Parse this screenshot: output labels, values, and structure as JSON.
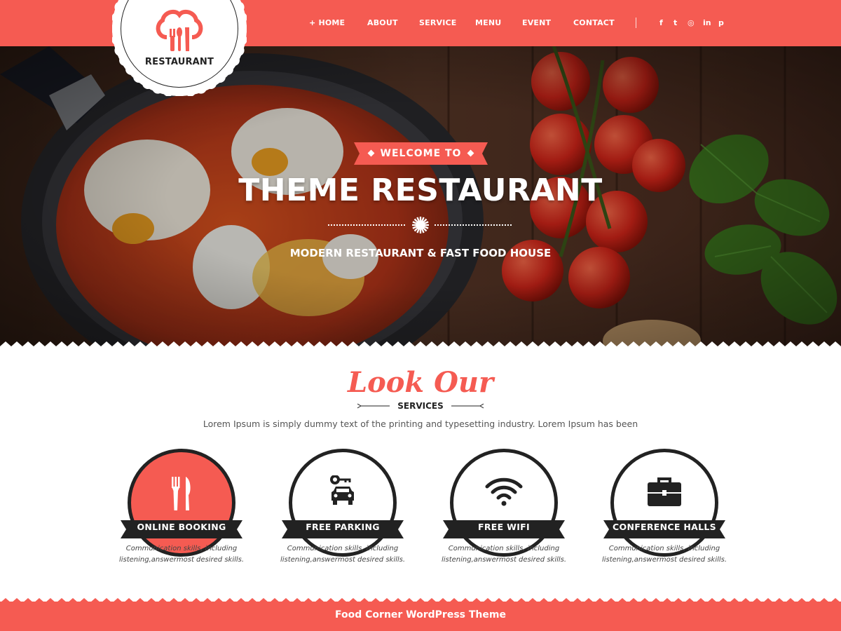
{
  "brand": {
    "logo_text": "RESTAURANT",
    "accent_color": "#f55b52",
    "dark_color": "#222222"
  },
  "nav": {
    "items": [
      "+ HOME",
      "ABOUT",
      "SERVICE",
      "MENU",
      "EVENT",
      "CONTACT"
    ]
  },
  "social": {
    "icons": [
      {
        "name": "facebook-icon",
        "glyph": "f"
      },
      {
        "name": "twitter-icon",
        "glyph": "t"
      },
      {
        "name": "instagram-icon",
        "glyph": "◎"
      },
      {
        "name": "linkedin-icon",
        "glyph": "in"
      },
      {
        "name": "pinterest-icon",
        "glyph": "p"
      }
    ]
  },
  "hero": {
    "tag": "WELCOME TO",
    "title": "THEME RESTAURANT",
    "subtitle": "MODERN RESTAURANT & FAST FOOD HOUSE"
  },
  "services": {
    "title": "Look Our",
    "subtitle": "SERVICES",
    "description": "Lorem Ipsum is simply dummy text of the printing and typesetting industry. Lorem Ipsum has been",
    "cards": [
      {
        "label": "ONLINE BOOKING",
        "icon": "cutlery-icon",
        "active": true,
        "desc_line1": "Communication skills, including",
        "desc_line2": "listening,answermost desired skills."
      },
      {
        "label": "FREE PARKING",
        "icon": "car-key-icon",
        "active": false,
        "desc_line1": "Communication skills, including",
        "desc_line2": "listening,answermost desired skills."
      },
      {
        "label": "FREE WIFI",
        "icon": "wifi-icon",
        "active": false,
        "desc_line1": "Communication skills, including",
        "desc_line2": "listening,answermost desired skills."
      },
      {
        "label": "CONFERENCE HALLS",
        "icon": "briefcase-icon",
        "active": false,
        "desc_line1": "Communication skills, including",
        "desc_line2": "listening,answermost desired skills."
      }
    ]
  },
  "footer": {
    "text": "Food Corner WordPress Theme"
  }
}
